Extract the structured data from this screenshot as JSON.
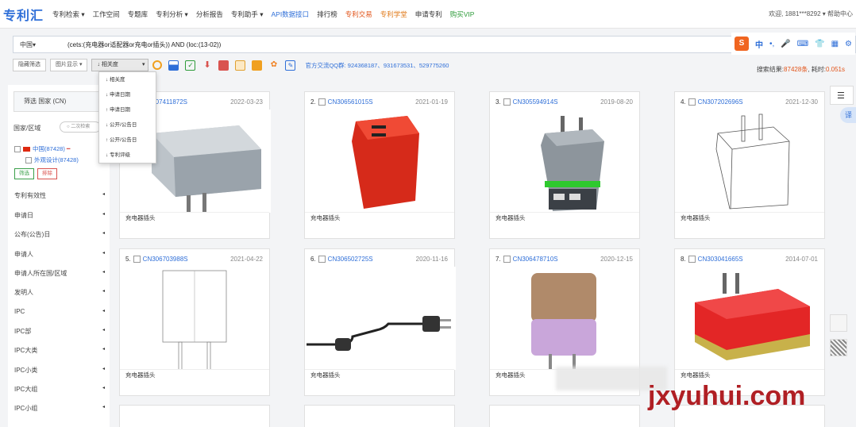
{
  "nav": {
    "logo": "专利汇",
    "items": [
      {
        "label": "专利检索 ▾",
        "style": "normal"
      },
      {
        "label": "工作空间",
        "style": "normal"
      },
      {
        "label": "专题库",
        "style": "normal"
      },
      {
        "label": "专利分析 ▾",
        "style": "normal"
      },
      {
        "label": "分析报告",
        "style": "normal"
      },
      {
        "label": "专利助手 ▾",
        "style": "normal"
      },
      {
        "label": "API数据接口",
        "style": "blue"
      },
      {
        "label": "排行榜",
        "style": "normal"
      },
      {
        "label": "专利交易",
        "style": "red"
      },
      {
        "label": "专利学堂",
        "style": "orange"
      },
      {
        "label": "申请专利",
        "style": "normal"
      },
      {
        "label": "购买VIP",
        "style": "green"
      }
    ],
    "user": "欢迎, 1881***8292 ▾  帮助中心"
  },
  "search": {
    "country": "中国▾",
    "query": "(cets:(充电器or适配器or充电or插头)) AND (loc:(13-02))"
  },
  "toolbar": {
    "hide_filter": "隐藏筛选",
    "image_view": "图片显示 ▾",
    "sort_selected": "↓ 相关度",
    "qq_group": "官方交流QQ群: 924368187、931673531、529775260"
  },
  "sort_options": [
    "↓ 相关度",
    "↓ 申请日期",
    "↑ 申请日期",
    "↓ 公开/公告日",
    "↑ 公开/公告日",
    "↓ 专利评级"
  ],
  "stats": {
    "prefix": "搜索结果:",
    "count": "87428条",
    "mid": ", 耗时:",
    "time": "0.051s"
  },
  "sidebar": {
    "filter_head": "筛选 国家 (CN)",
    "region_label": "国家/区域",
    "second_search": "○ 二次检索",
    "country_item": "中国(87428)",
    "design_item": "外观设计(87428)",
    "btn_filter": "筛选",
    "btn_exclude": "排除",
    "facets": [
      "专利有效性",
      "申请日",
      "公布(公告)日",
      "申请人",
      "申请人所在国/区域",
      "发明人",
      "IPC",
      "IPC部",
      "IPC大类",
      "IPC小类",
      "IPC大组",
      "IPC小组"
    ]
  },
  "cards": [
    {
      "num": "1.",
      "id": "CN307411872S",
      "date": "2022-03-23",
      "title": "充电器插头",
      "kind": "grey-charger"
    },
    {
      "num": "2.",
      "id": "CN306561015S",
      "date": "2021-01-19",
      "title": "充电器插头",
      "kind": "red-charger"
    },
    {
      "num": "3.",
      "id": "CN305594914S",
      "date": "2019-08-20",
      "title": "充电器插头",
      "kind": "silver-charger"
    },
    {
      "num": "4.",
      "id": "CN307202696S",
      "date": "2021-12-30",
      "title": "充电器插头",
      "kind": "line-charger"
    },
    {
      "num": "5.",
      "id": "CN306703988S",
      "date": "2021-04-22",
      "title": "充电器插头",
      "kind": "flat-charger"
    },
    {
      "num": "6.",
      "id": "CN306502725S",
      "date": "2020-11-16",
      "title": "充电器插头",
      "kind": "cable-plug"
    },
    {
      "num": "7.",
      "id": "CN306478710S",
      "date": "2020-12-15",
      "title": "充电器插头",
      "kind": "brown-charger"
    },
    {
      "num": "8.",
      "id": "CN303041665S",
      "date": "2014-07-01",
      "title": "充电器插头",
      "kind": "red-box"
    }
  ],
  "watermark": "jxyuhui.com",
  "colors": {
    "accent": "#2f6fd8",
    "red": "#e2541a",
    "green": "#2e9b3a"
  }
}
